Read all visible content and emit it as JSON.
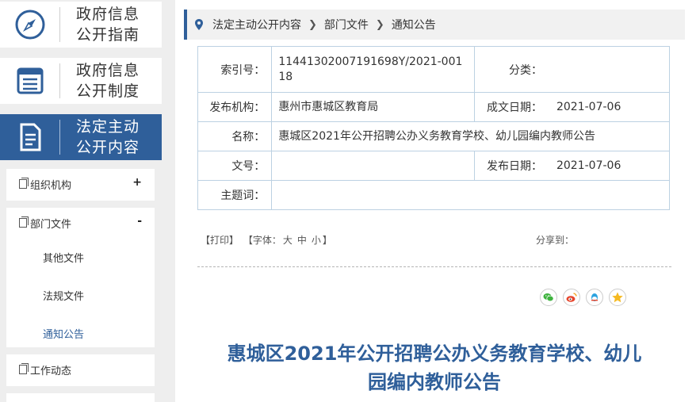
{
  "sidebar": {
    "cards": [
      {
        "line1": "政府信息",
        "line2": "公开指南",
        "icon": "compass-icon"
      },
      {
        "line1": "政府信息",
        "line2": "公开制度",
        "icon": "list-icon"
      },
      {
        "line1": "法定主动",
        "line2": "公开内容",
        "icon": "document-icon"
      }
    ],
    "groups": {
      "org": {
        "label": "组织机构",
        "toggle": "+"
      },
      "dept": {
        "label": "部门文件",
        "toggle": "-",
        "subs": [
          "其他文件",
          "法规文件",
          "通知公告"
        ]
      },
      "work": {
        "label": "工作动态"
      }
    }
  },
  "breadcrumb": {
    "items": [
      "法定主动公开内容",
      "部门文件",
      "通知公告"
    ]
  },
  "meta": {
    "index_label": "索引号：",
    "index_value": "11441302007191698Y/2021-00118",
    "category_label": "分类：",
    "category_value": "",
    "publisher_label": "发布机构：",
    "publisher_value": "惠州市惠城区教育局",
    "created_label": "成文日期：",
    "created_value": "2021-07-06",
    "name_label": "名称：",
    "name_value": "惠城区2021年公开招聘公办义务教育学校、幼儿园编内教师公告",
    "docno_label": "文号：",
    "docno_value": "",
    "published_label": "发布日期：",
    "published_value": "2021-07-06",
    "keywords_label": "主题词：",
    "keywords_value": ""
  },
  "tools": {
    "print": "【打印】",
    "fontsize": "【字体：",
    "large": "大",
    "medium": "中",
    "small": "小",
    "end": "】",
    "share": "分享到："
  },
  "share_icons": [
    "wechat-icon",
    "weibo-icon",
    "qq-icon",
    "qzone-icon"
  ],
  "article": {
    "title_line1": "惠城区2021年公开招聘公办义务教育学校、幼儿",
    "title_line2": "园编内教师公告"
  },
  "colors": {
    "accent": "#2f5f9a",
    "border": "#bcd1e2"
  }
}
